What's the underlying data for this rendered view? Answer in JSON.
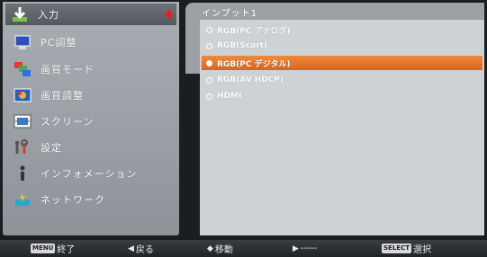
{
  "menu": {
    "items": [
      {
        "id": "input",
        "label": "入力",
        "icon": "input-icon"
      },
      {
        "id": "pc-adjust",
        "label": "PC調整",
        "icon": "pc-monitor-icon"
      },
      {
        "id": "picture-mode",
        "label": "画質モード",
        "icon": "image-mode-icon"
      },
      {
        "id": "picture-adjust",
        "label": "画質調整",
        "icon": "picture-adjust-icon"
      },
      {
        "id": "screen",
        "label": "スクリーン",
        "icon": "screen-icon"
      },
      {
        "id": "settings",
        "label": "設定",
        "icon": "settings-tools-icon"
      },
      {
        "id": "information",
        "label": "インフォメーション",
        "icon": "information-icon"
      },
      {
        "id": "network",
        "label": "ネットワーク",
        "icon": "network-icon"
      }
    ],
    "selected_index": 0
  },
  "submenu": {
    "title": "インプット1",
    "options": [
      {
        "label": "RGB(PC アナログ)",
        "selected": false
      },
      {
        "label": "RGB(Scart)",
        "selected": false
      },
      {
        "label": "RGB(PC デジタル)",
        "selected": true
      },
      {
        "label": "RGB(AV HDCP)",
        "selected": false
      },
      {
        "label": "HDMI",
        "selected": false
      }
    ]
  },
  "status_bar": {
    "exit": {
      "key": "MENU",
      "label": "終了"
    },
    "back": {
      "glyph": "◀",
      "label": "戻る"
    },
    "move": {
      "glyph": "◆",
      "label": "移動"
    },
    "next": {
      "glyph": "▶",
      "label": "-----"
    },
    "select": {
      "key": "SELECT",
      "label": "選択"
    }
  },
  "colors": {
    "selection_orange": "#e8762a",
    "selection_arrow_red": "#e0231f",
    "menu_panel_gray": "#9ea3a8"
  }
}
